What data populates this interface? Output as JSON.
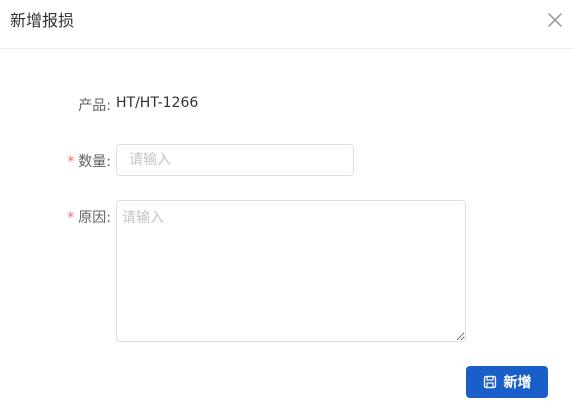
{
  "dialog": {
    "title": "新增报损",
    "close_icon": "close-icon"
  },
  "form": {
    "product": {
      "label": "产品:",
      "value": "HT/HT-1266"
    },
    "quantity": {
      "required_mark": "*",
      "label": "数量:",
      "placeholder": "请输入",
      "value": ""
    },
    "reason": {
      "required_mark": "*",
      "label": "原因:",
      "placeholder": "请输入",
      "value": ""
    }
  },
  "footer": {
    "submit_label": "新增",
    "submit_icon": "save-icon",
    "accent_color": "#1a5ec9"
  }
}
